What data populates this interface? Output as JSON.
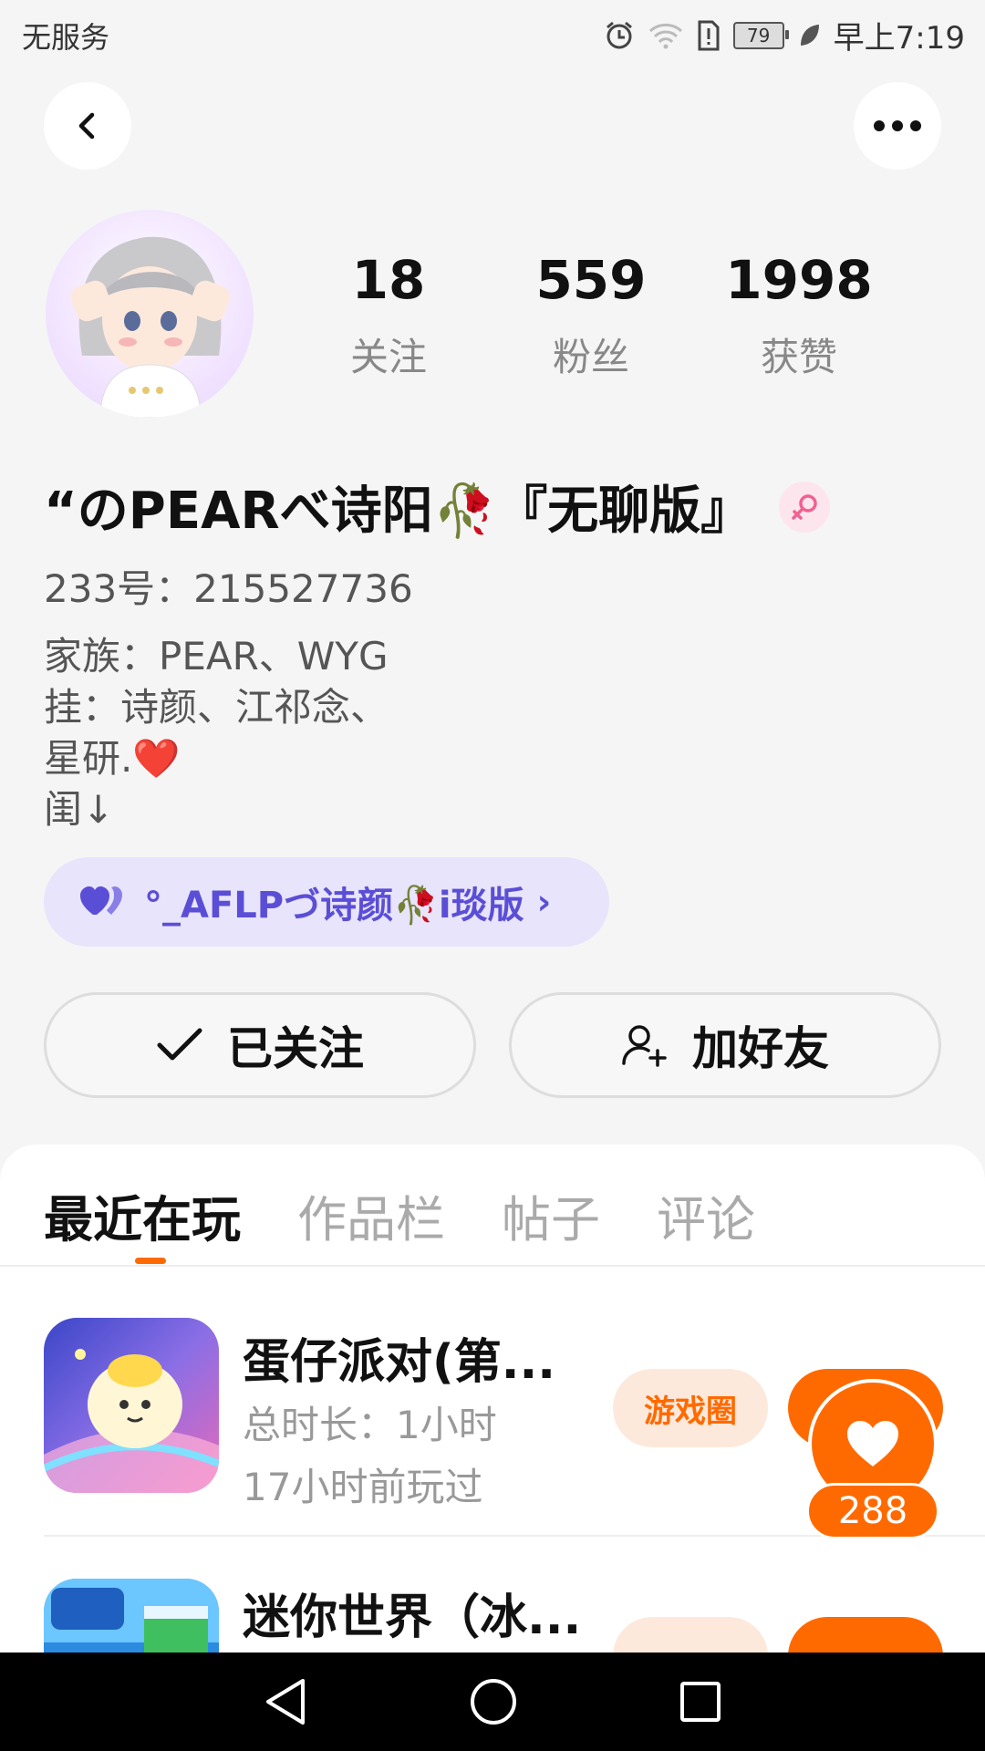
{
  "status_bar": {
    "carrier": "无服务",
    "battery": "79",
    "time": "早上7:19"
  },
  "profile": {
    "stats": [
      {
        "value": "18",
        "label": "关注"
      },
      {
        "value": "559",
        "label": "粉丝"
      },
      {
        "value": "1998",
        "label": "获赞"
      }
    ],
    "name": "“のPEARべ诗阳🥀『无聊版』",
    "uid": "233号：215527736",
    "bio_lines": [
      "家族：PEAR、WYG",
      "挂：诗颜、江祁念、",
      "星研.❤️",
      "闺↓"
    ],
    "family_tag": "°_AFLPづ诗颜🥀i琰版"
  },
  "actions": {
    "follow_label": "已关注",
    "add_friend_label": "加好友"
  },
  "tabs": [
    "最近在玩",
    "作品栏",
    "帖子",
    "评论"
  ],
  "games": [
    {
      "title": "蛋仔派对(第...",
      "duration": "总时长：1小时",
      "last_played": "17小时前玩过",
      "circle_label": "游戏圈"
    },
    {
      "title": "迷你世界（冰...",
      "duration": "",
      "last_played": "",
      "circle_label": ""
    }
  ],
  "like_count": "288",
  "colors": {
    "accent": "#ff6a00",
    "family_tag_bg": "#e8e4fb",
    "family_tag_text": "#5b4ed6"
  }
}
